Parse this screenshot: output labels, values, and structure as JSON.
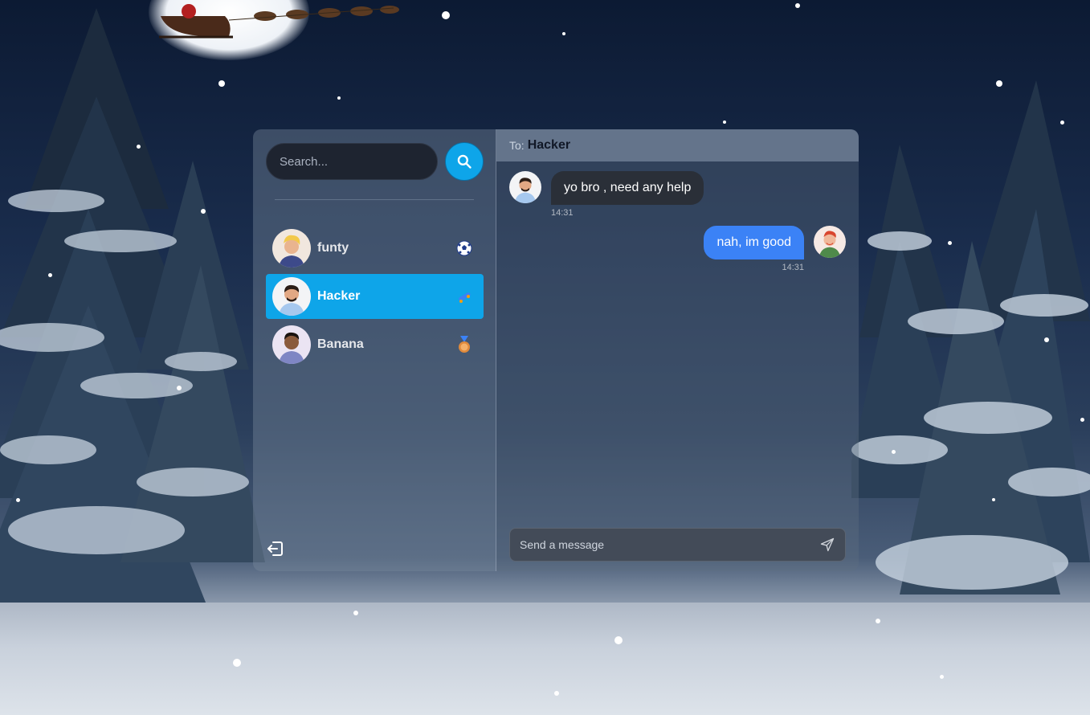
{
  "search": {
    "placeholder": "Search..."
  },
  "contacts": [
    {
      "name": "funty",
      "emoji": "soccer-ball-icon"
    },
    {
      "name": "Hacker",
      "emoji": "skateboard-icon",
      "active": true
    },
    {
      "name": "Banana",
      "emoji": "medal-icon"
    }
  ],
  "chat": {
    "to_label": "To:",
    "to_name": "Hacker",
    "messages": [
      {
        "text": "yo bro , need any help",
        "time": "14:31",
        "direction": "incoming"
      },
      {
        "text": "nah, im good",
        "time": "14:31",
        "direction": "outgoing"
      }
    ],
    "composer_placeholder": "Send a message"
  },
  "colors": {
    "accent": "#0ea5e9",
    "outgoing_bubble": "#3b82f6",
    "incoming_bubble": "#2a2f38",
    "header": "#64748b"
  }
}
